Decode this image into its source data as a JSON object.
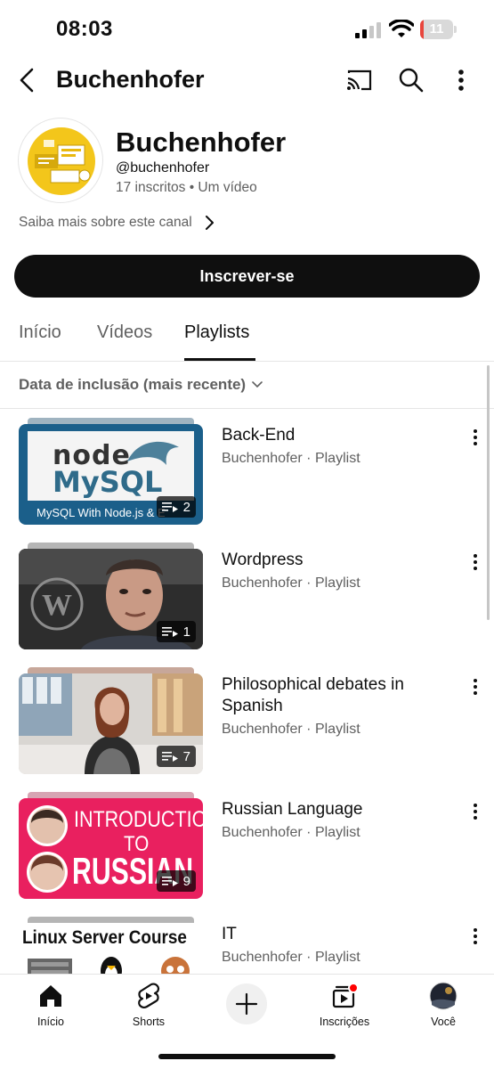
{
  "status": {
    "time": "08:03",
    "battery": "11",
    "battery_level": 0.11,
    "battery_color": "#e8453c"
  },
  "header": {
    "title": "Buchenhofer"
  },
  "channel": {
    "name": "Buchenhofer",
    "handle": "@buchenhofer",
    "stats": "17 inscritos • Um vídeo",
    "about": "Saiba mais sobre este canal",
    "subscribe_label": "Inscrever-se"
  },
  "tabs": [
    {
      "label": "Início"
    },
    {
      "label": "Vídeos"
    },
    {
      "label": "Playlists",
      "active": true
    }
  ],
  "sort": {
    "label": "Data de inclusão (mais recente)"
  },
  "playlists": [
    {
      "title": "Back-End",
      "subtitle": "Buchenhofer · Playlist",
      "count": "2",
      "thumb": {
        "kind": "node-mysql",
        "line1": "node",
        "line2": "MySQL",
        "caption": "MySQL With Node.js & E"
      }
    },
    {
      "title": "Wordpress",
      "subtitle": "Buchenhofer · Playlist",
      "count": "1",
      "thumb": {
        "kind": "wordpress"
      }
    },
    {
      "title": "Philosophical debates in Spanish",
      "subtitle": "Buchenhofer · Playlist",
      "count": "7",
      "thumb": {
        "kind": "studio"
      }
    },
    {
      "title": "Russian Language",
      "subtitle": "Buchenhofer · Playlist",
      "count": "9",
      "thumb": {
        "kind": "russian",
        "line1": "INTRODUCTION",
        "line2": "TO",
        "line3": "RUSSIAN"
      }
    },
    {
      "title": "IT",
      "subtitle": "Buchenhofer · Playlist",
      "count": "",
      "thumb": {
        "kind": "linux",
        "line1": "Linux Server Course"
      }
    }
  ],
  "nav": [
    {
      "label": "Início",
      "icon": "home-icon",
      "active": true
    },
    {
      "label": "Shorts",
      "icon": "shorts-icon"
    },
    {
      "label": "",
      "icon": "plus-icon"
    },
    {
      "label": "Inscrições",
      "icon": "subscriptions-icon"
    },
    {
      "label": "Você",
      "icon": "profile-avatar"
    }
  ],
  "colors": {
    "accent": "#0f0f0f",
    "muted": "#606060",
    "badge_red": "#ff0000",
    "russian_pink": "#e9205f"
  }
}
